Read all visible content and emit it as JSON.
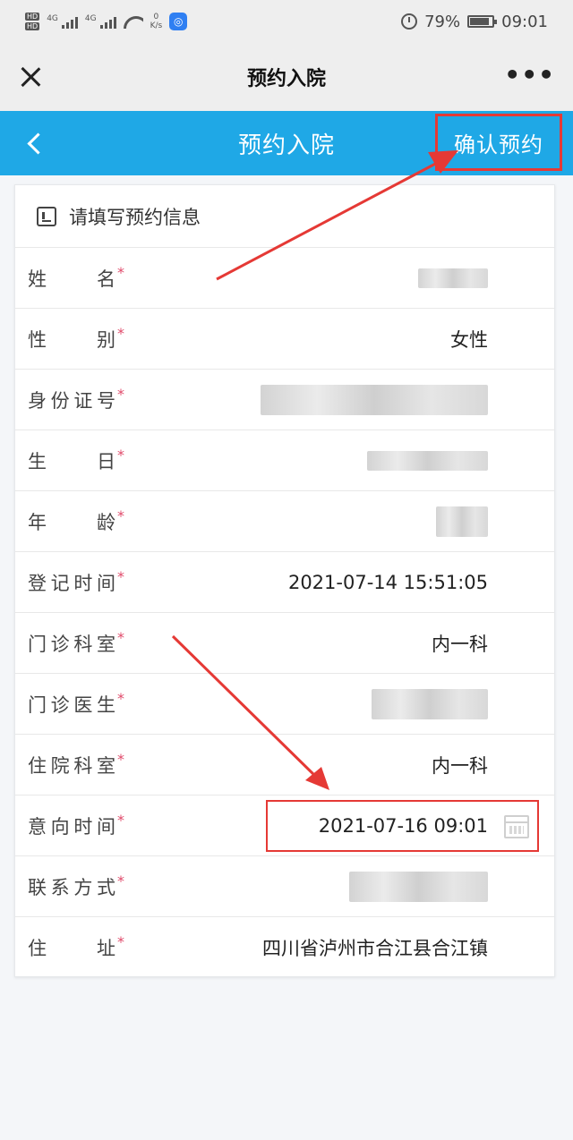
{
  "status_bar": {
    "network_a": "4G",
    "network_b": "4G",
    "speed_value": "0",
    "speed_unit": "K/s",
    "battery": "79%",
    "time": "09:01"
  },
  "nav": {
    "title": "预约入院",
    "more": "•••"
  },
  "header": {
    "title": "预约入院",
    "confirm_label": "确认预约"
  },
  "form": {
    "section_title": "请填写预约信息",
    "required_mark": "*",
    "fields": [
      {
        "label": "姓名",
        "value": ""
      },
      {
        "label": "性别",
        "value": "女性"
      },
      {
        "label": "身份证号",
        "value": ""
      },
      {
        "label": "生日",
        "value": ""
      },
      {
        "label": "年龄",
        "value": ""
      },
      {
        "label": "登记时间",
        "value": "2021-07-14 15:51:05"
      },
      {
        "label": "门诊科室",
        "value": "内一科"
      },
      {
        "label": "门诊医生",
        "value": ""
      },
      {
        "label": "住院科室",
        "value": "内一科"
      },
      {
        "label": "意向时间",
        "value": "2021-07-16 09:01"
      },
      {
        "label": "联系方式",
        "value": ""
      },
      {
        "label": "住址",
        "value": "四川省泸州市合江县合江镇"
      }
    ]
  },
  "colors": {
    "header_blue": "#1fa8e6",
    "highlight_red": "#e53935",
    "required_pink": "#e04a6a"
  },
  "icons": [
    "close-icon",
    "more-icon",
    "back-icon",
    "form-icon",
    "calendar-icon"
  ]
}
